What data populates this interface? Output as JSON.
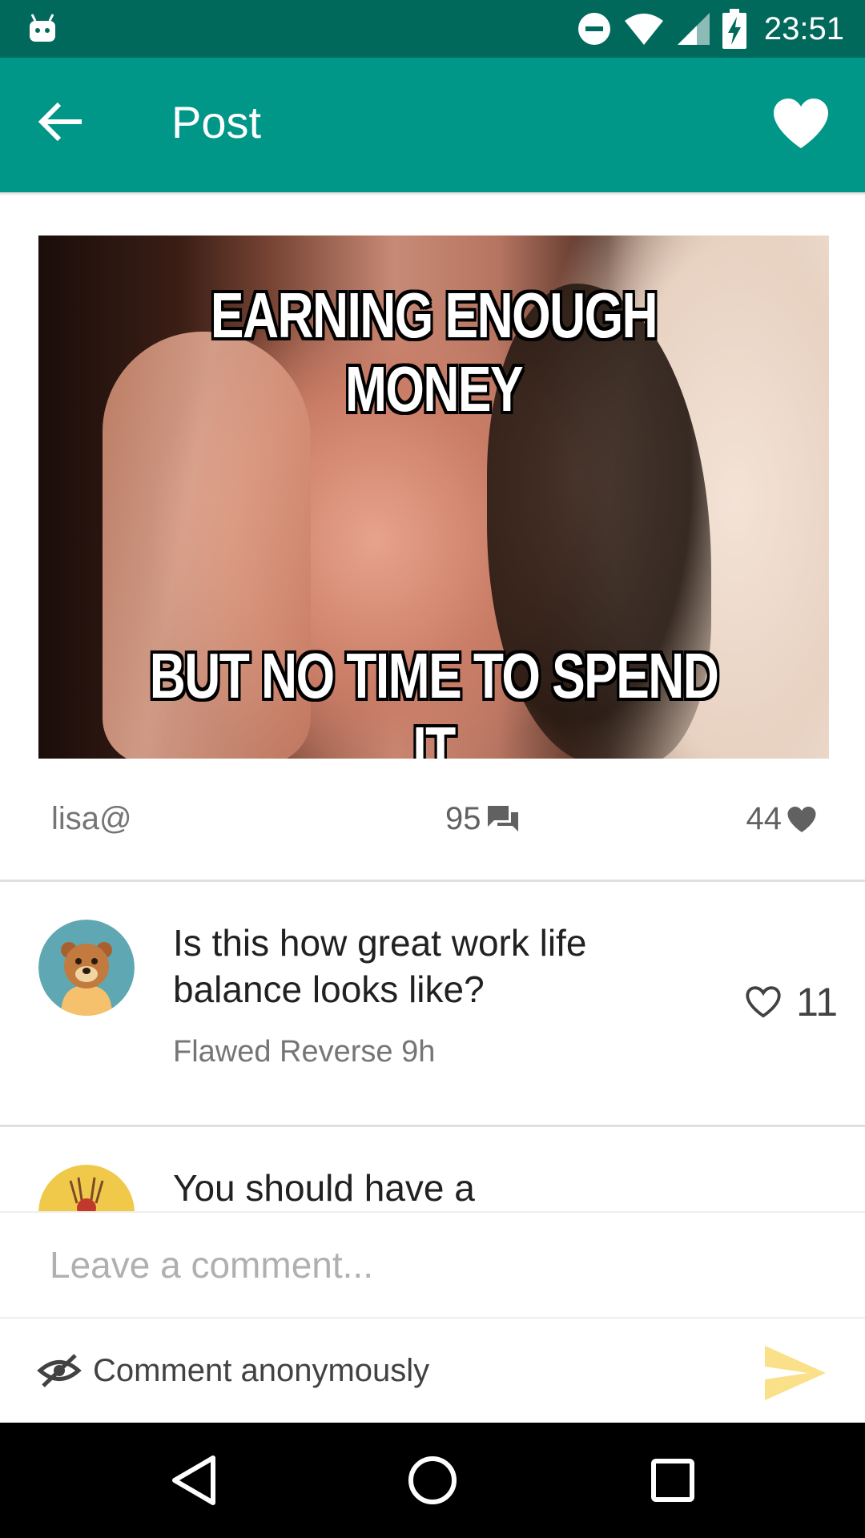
{
  "status_bar": {
    "time": "23:51",
    "icons": [
      "android-icon",
      "do-not-disturb-icon",
      "wifi-icon",
      "cell-signal-icon",
      "battery-charging-icon"
    ]
  },
  "app_bar": {
    "title": "Post",
    "back_icon": "arrow-back-icon",
    "favorite_icon": "heart-icon",
    "color": "#009688",
    "status_color": "#00695c"
  },
  "post": {
    "image_top_text": "EARNING ENOUGH MONEY",
    "image_bottom_text": "BUT NO TIME TO SPEND IT",
    "author": "lisa@",
    "comment_count": "95",
    "like_count": "44"
  },
  "comments": [
    {
      "text": "Is this how great work life balance looks like?",
      "author": "Flawed Reverse",
      "age": "9h",
      "likes": "11",
      "avatar": "bear-avatar",
      "avatar_bg": "#5fa8b3"
    },
    {
      "text": "You should have a",
      "avatar": "spider-avatar",
      "avatar_bg": "#f0c94a"
    }
  ],
  "composer": {
    "placeholder": "Leave a comment...",
    "anonymous_label": "Comment anonymously",
    "send_color": "#fbe08a"
  },
  "nav_bar": {
    "buttons": [
      "back-triangle-icon",
      "home-circle-icon",
      "recents-square-icon"
    ]
  }
}
